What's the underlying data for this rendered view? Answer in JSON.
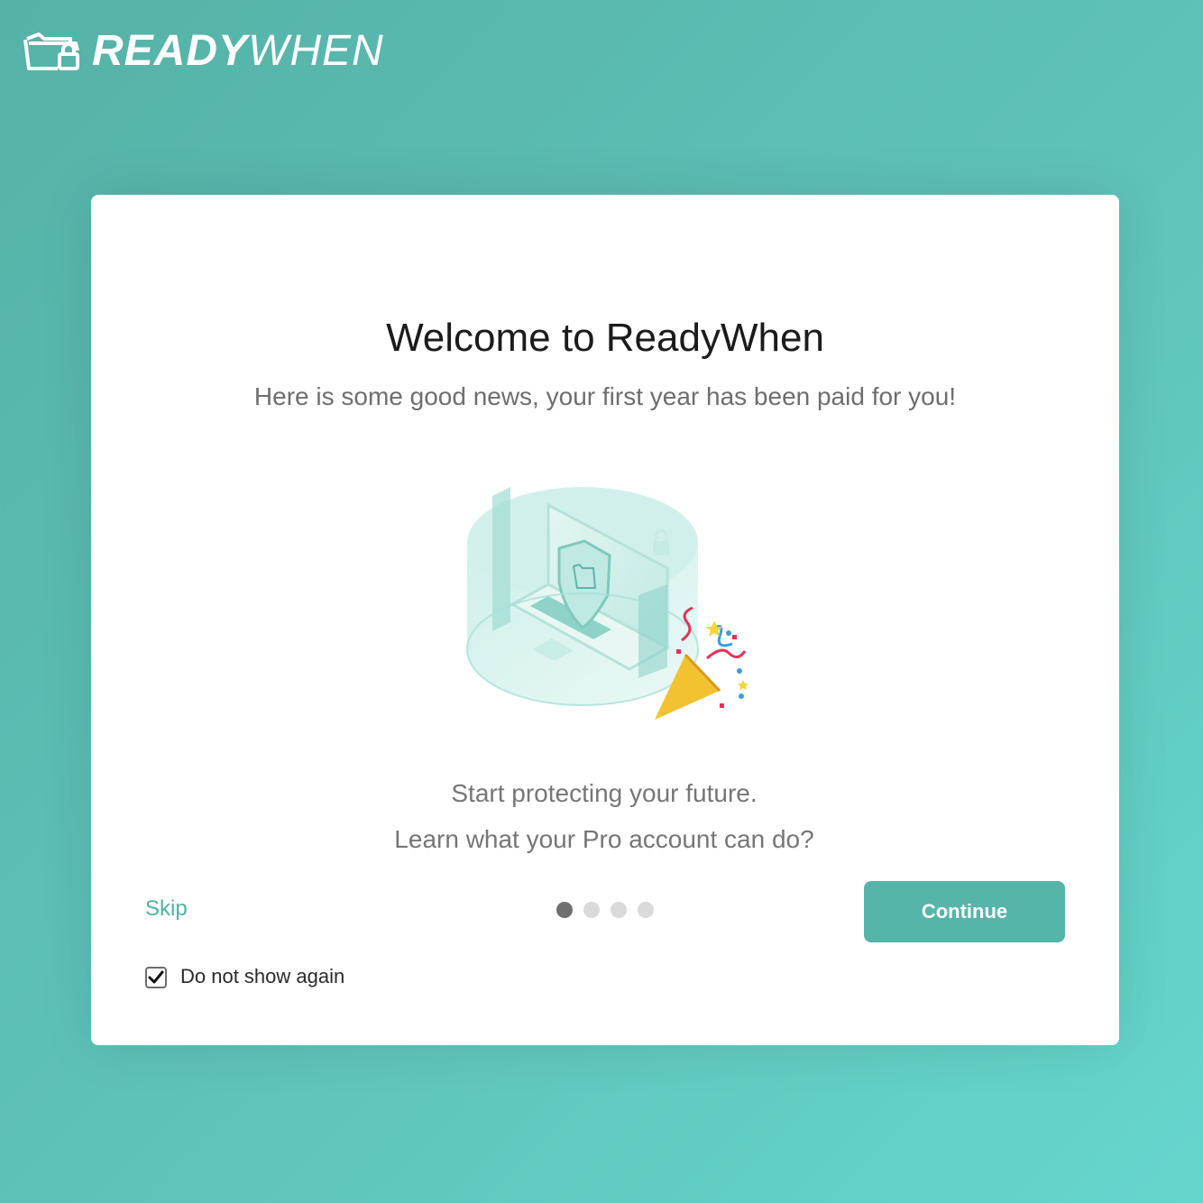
{
  "brand": {
    "name_bold": "READY",
    "name_light": "WHEN",
    "icon": "folder-lock-icon",
    "color": "#ffffff"
  },
  "colors": {
    "accent": "#55b5a9",
    "background": "#5fc3bb",
    "card": "#ffffff"
  },
  "welcome": {
    "title": "Welcome to ReadyWhen",
    "subtitle": "Here is some good news, your first year has been paid for you!",
    "illustration_icon": "laptop-shield-party-icon",
    "line1": "Start protecting your future.",
    "line2": "Learn what your Pro account can do?"
  },
  "footer": {
    "skip_label": "Skip",
    "continue_label": "Continue",
    "pagination": {
      "current": 1,
      "total": 4
    },
    "checkbox": {
      "label": "Do not show again",
      "checked": true
    }
  }
}
